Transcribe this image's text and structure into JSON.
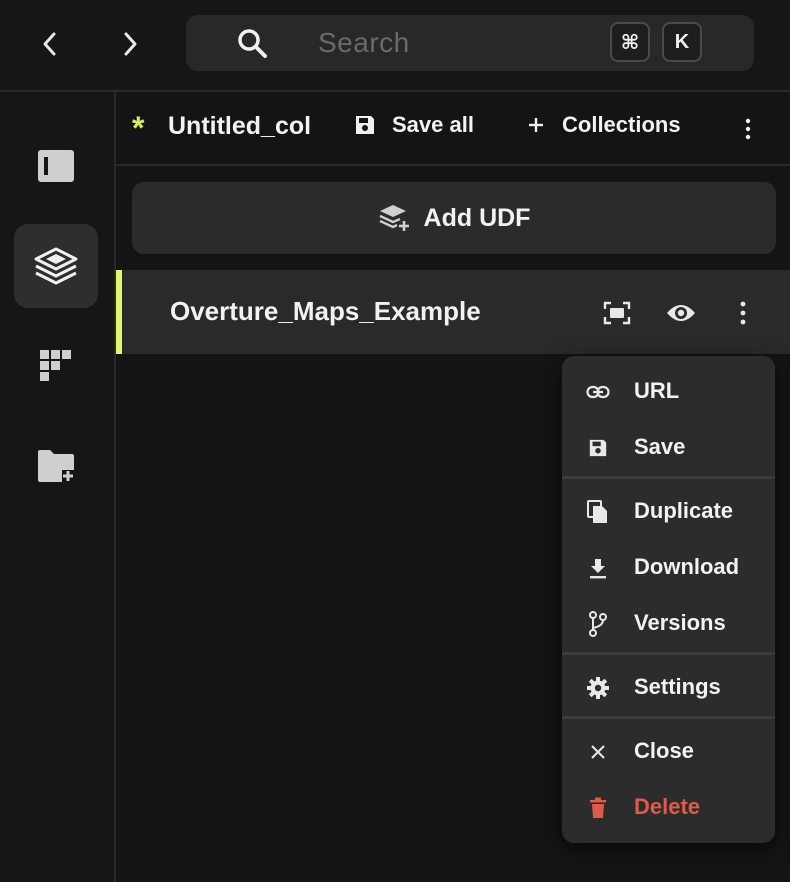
{
  "topbar": {
    "search": {
      "placeholder": "Search",
      "shortcut_keys": [
        "⌘",
        "K"
      ],
      "icon": "search-icon"
    },
    "nav": {
      "back_icon": "chevron-left-icon",
      "forward_icon": "chevron-right-icon"
    }
  },
  "sidebar": {
    "items": [
      {
        "icon": "panel-icon",
        "active": false
      },
      {
        "icon": "layers-icon",
        "active": true
      },
      {
        "icon": "grid-blocks-icon",
        "active": false
      },
      {
        "icon": "folder-add-icon",
        "active": false
      }
    ]
  },
  "header": {
    "unsaved_marker": "*",
    "title": "Untitled_col",
    "save_all_label": "Save all",
    "collections_label": "Collections"
  },
  "add_udf_label": "Add UDF",
  "udf": {
    "name": "Overture_Maps_Example",
    "accent_color": "#e3f56a"
  },
  "menu": {
    "items": [
      {
        "label": "URL",
        "icon": "link-icon"
      },
      {
        "label": "Save",
        "icon": "save-icon"
      },
      {
        "label": "Duplicate",
        "icon": "duplicate-icon"
      },
      {
        "label": "Download",
        "icon": "download-icon"
      },
      {
        "label": "Versions",
        "icon": "branch-icon"
      },
      {
        "label": "Settings",
        "icon": "gear-icon"
      },
      {
        "label": "Close",
        "icon": "close-icon"
      },
      {
        "label": "Delete",
        "icon": "trash-icon",
        "color": "#e05a4a"
      }
    ]
  }
}
